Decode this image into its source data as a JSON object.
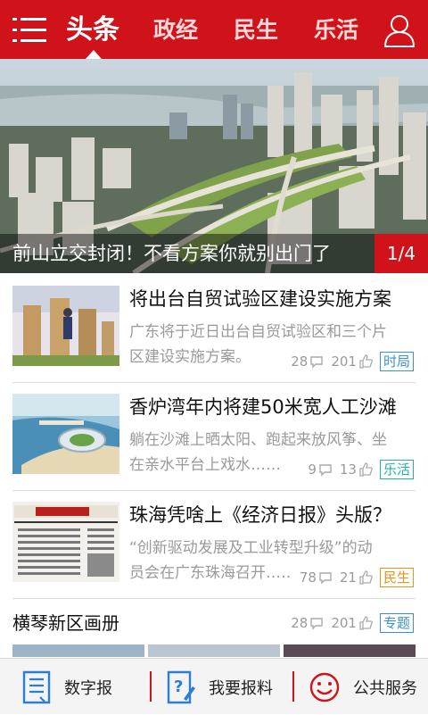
{
  "header": {
    "tabs": [
      {
        "label": "头条",
        "active": true
      },
      {
        "label": "政经",
        "active": false
      },
      {
        "label": "民生",
        "active": false
      },
      {
        "label": "乐活",
        "active": false
      }
    ],
    "menu_icon": "hamburger-menu-icon",
    "user_icon": "user-profile-icon"
  },
  "hero": {
    "caption": "前山立交封闭！不看方案你就别出门了",
    "pager": "1/4"
  },
  "news": [
    {
      "title": "将出台自贸试验区建设实施方案",
      "summary_line1": "广东将于近日出台自贸试验区和三个片",
      "summary_line2": "区建设实施方案。",
      "comments": "28",
      "likes": "201",
      "tag": "时局",
      "tag_color": "#3a8fd8"
    },
    {
      "title": "香炉湾年内将建50米宽人工沙滩",
      "summary_line1": "躺在沙滩上晒太阳、跑起来放风筝、坐",
      "summary_line2": "在亲水平台上戏水……",
      "comments": "9",
      "likes": "13",
      "tag": "乐活",
      "tag_color": "#23b3a0"
    },
    {
      "title": "珠海凭啥上《经济日报》头版？",
      "summary_line1": "“创新驱动发展及工业转型升级”的动",
      "summary_line2": "员会在广东珠海召开……",
      "comments": "78",
      "likes": "21",
      "tag": "民生",
      "tag_color": "#e8931c"
    }
  ],
  "album": {
    "title": "横琴新区画册",
    "comments": "28",
    "likes": "201",
    "tag": "专题",
    "tag_color": "#3a8fd8"
  },
  "bottom_nav": [
    {
      "label": "数字报",
      "icon": "newspaper-icon"
    },
    {
      "label": "我要报料",
      "icon": "report-tip-icon"
    },
    {
      "label": "公共服务",
      "icon": "smiley-service-icon"
    }
  ],
  "colors": {
    "brand_red": "#d0121b",
    "icon_blue": "#2a7fd4"
  }
}
